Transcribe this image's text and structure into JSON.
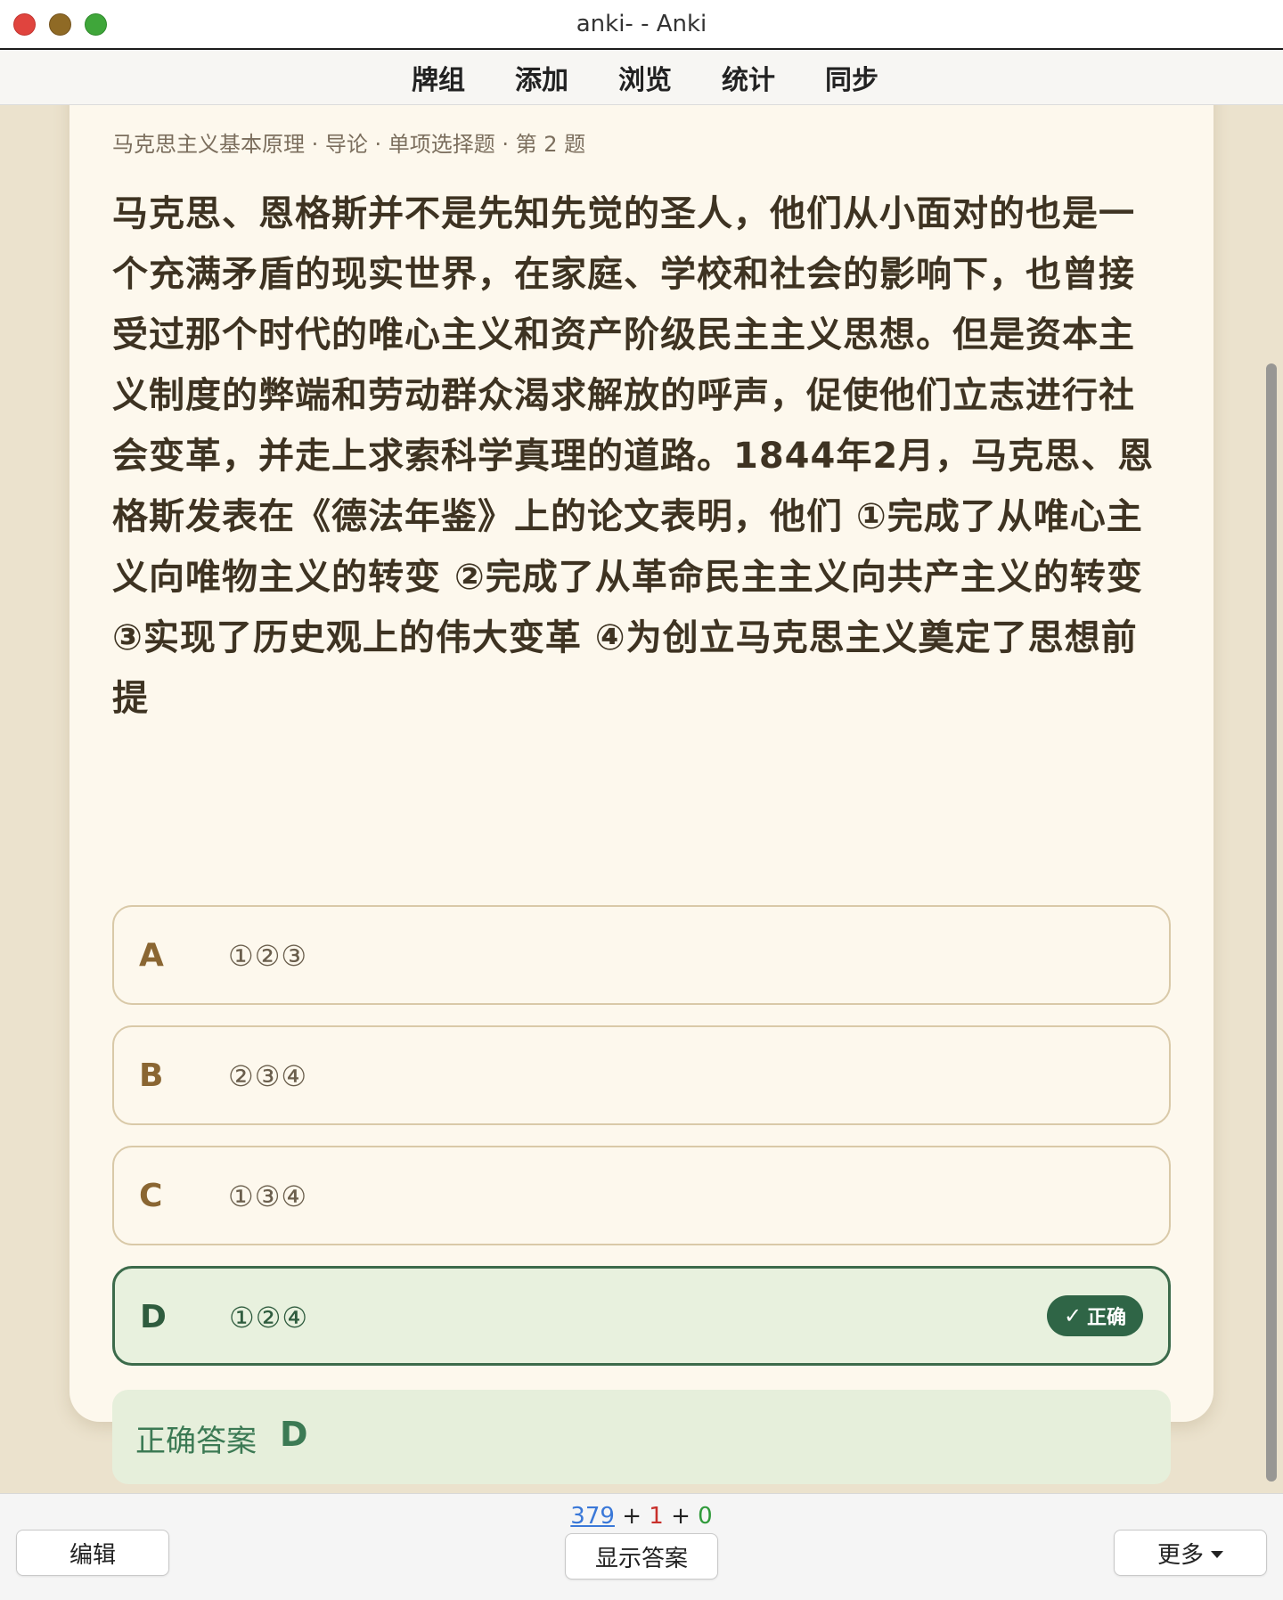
{
  "window": {
    "title": "anki- - Anki"
  },
  "toolbar": {
    "items": [
      "牌组",
      "添加",
      "浏览",
      "统计",
      "同步"
    ]
  },
  "card": {
    "breadcrumb": "马克思主义基本原理 · 导论 · 单项选择题 · 第 2 题",
    "question": "马克思、恩格斯并不是先知先觉的圣人，他们从小面对的也是一个充满矛盾的现实世界，在家庭、学校和社会的影响下，也曾接受过那个时代的唯心主义和资产阶级民主主义思想。但是资本主义制度的弊端和劳动群众渴求解放的呼声，促使他们立志进行社会变革，并走上求索科学真理的道路。1844年2月，马克思、恩格斯发表在《德法年鉴》上的论文表明，他们 ①完成了从唯心主义向唯物主义的转变 ②完成了从革命民主主义向共产主义的转变 ③实现了历史观上的伟大变革 ④为创立马克思主义奠定了思想前提",
    "options": [
      {
        "letter": "A",
        "text": "①②③"
      },
      {
        "letter": "B",
        "text": "②③④"
      },
      {
        "letter": "C",
        "text": "①③④"
      },
      {
        "letter": "D",
        "text": "①②④"
      }
    ],
    "correct_badge": "正确",
    "answer_label": "正确答案",
    "answer_value": "D"
  },
  "bottom": {
    "counts": {
      "new": "379",
      "sep1": " + ",
      "learn": "1",
      "sep2": " + ",
      "review": "0"
    },
    "edit_label": "编辑",
    "show_answer_label": "显示答案",
    "more_label": "更多"
  },
  "colors": {
    "background": "#ebe2cd",
    "card": "#fdf8ed",
    "correct_border": "#3c6b4b",
    "correct_bg": "#e8f1de",
    "badge": "#2f6546",
    "new_count": "#3a78d8",
    "learn_count": "#c8302c",
    "review_count": "#2f9a3a"
  }
}
